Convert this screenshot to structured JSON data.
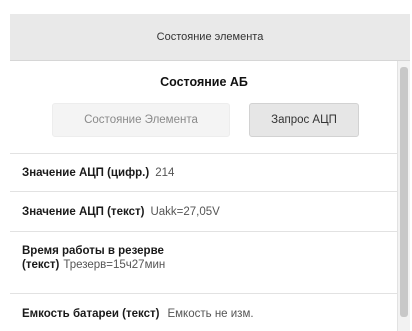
{
  "header": {
    "title": "Состояние элемента"
  },
  "section": {
    "title": "Состояние АБ"
  },
  "buttons": {
    "state_label": "Состояние Элемента",
    "adc_label": "Запрос АЦП"
  },
  "rows": [
    {
      "label": "Значение АЦП (цифр.)",
      "value": "214"
    },
    {
      "label": "Значение АЦП (текст)",
      "value": "Uakk=27,05V"
    },
    {
      "label_line1": "Время работы в резерве",
      "label_line2": "(текст)",
      "value": "Трезерв=15ч27мин"
    },
    {
      "label": "Емкость батареи (текст)",
      "value": "Емкость не изм."
    }
  ]
}
